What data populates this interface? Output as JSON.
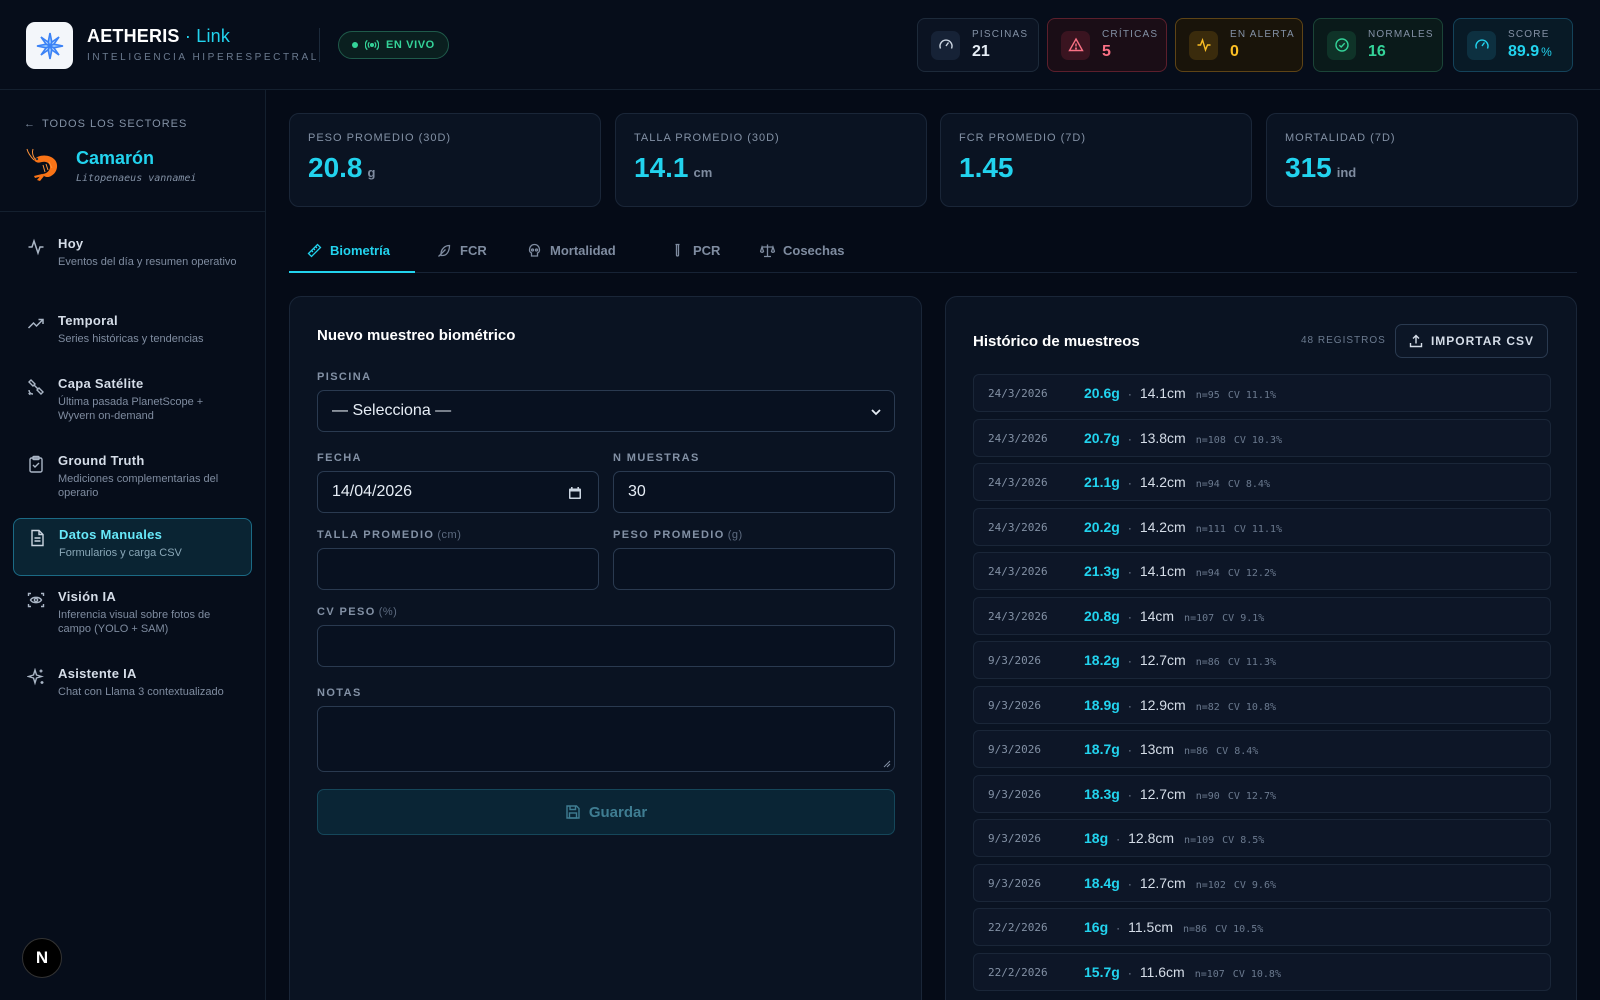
{
  "header": {
    "brand": "AETHERIS",
    "brand_sep": " · ",
    "brand_suffix": "Link",
    "subtitle": "INTELIGENCIA HIPERESPECTRAL",
    "live_label": "EN VIVO",
    "stats": [
      {
        "label": "PISCINAS",
        "value": "21",
        "icon": "gauge-icon"
      },
      {
        "label": "CRÍTICAS",
        "value": "5",
        "icon": "warning-triangle-icon"
      },
      {
        "label": "EN ALERTA",
        "value": "0",
        "icon": "activity-pulse-icon"
      },
      {
        "label": "NORMALES",
        "value": "16",
        "icon": "check-circle-icon"
      },
      {
        "label": "SCORE",
        "value": "89.9",
        "unit": "%",
        "icon": "gauge-icon"
      }
    ]
  },
  "sidebar": {
    "back_label": "TODOS LOS SECTORES",
    "species_name": "Camarón",
    "species_scientific": "Litopenaeus vannamei",
    "items": [
      {
        "title": "Hoy",
        "subtitle": "Eventos del día y resumen operativo",
        "icon": "activity-icon"
      },
      {
        "title": "Temporal",
        "subtitle": "Series históricas y tendencias",
        "icon": "trending-up-icon"
      },
      {
        "title": "Capa Satélite",
        "subtitle": "Última pasada PlanetScope + Wyvern on-demand",
        "icon": "satellite-icon"
      },
      {
        "title": "Ground Truth",
        "subtitle": "Mediciones complementarias del operario",
        "icon": "clipboard-check-icon"
      },
      {
        "title": "Datos Manuales",
        "subtitle": "Formularios y carga CSV",
        "icon": "file-text-icon",
        "active": true
      },
      {
        "title": "Visión IA",
        "subtitle": "Inferencia visual sobre fotos de campo (YOLO + SAM)",
        "icon": "scan-eye-icon"
      },
      {
        "title": "Asistente IA",
        "subtitle": "Chat con Llama 3 contextualizado",
        "icon": "sparkles-icon"
      }
    ]
  },
  "kpis": [
    {
      "label": "PESO PROMEDIO (30D)",
      "value": "20.8",
      "unit": "g"
    },
    {
      "label": "TALLA PROMEDIO (30D)",
      "value": "14.1",
      "unit": "cm"
    },
    {
      "label": "FCR PROMEDIO (7D)",
      "value": "1.45",
      "unit": ""
    },
    {
      "label": "MORTALIDAD (7D)",
      "value": "315",
      "unit": "ind"
    }
  ],
  "tabs": [
    {
      "label": "Biometría",
      "icon": "ruler-icon",
      "active": true
    },
    {
      "label": "FCR",
      "icon": "feather-icon"
    },
    {
      "label": "Mortalidad",
      "icon": "skull-icon"
    },
    {
      "label": "PCR",
      "icon": "test-tube-icon"
    },
    {
      "label": "Cosechas",
      "icon": "scale-icon"
    }
  ],
  "form": {
    "title": "Nuevo muestreo biométrico",
    "piscina_label": "PISCINA",
    "piscina_value": "— Selecciona —",
    "fecha_label": "FECHA",
    "fecha_value": "14/04/2026",
    "n_label": "N MUESTRAS",
    "n_value": "30",
    "talla_label": "TALLA PROMEDIO",
    "talla_unit": "(cm)",
    "talla_value": "",
    "peso_label": "PESO PROMEDIO",
    "peso_unit": "(g)",
    "peso_value": "",
    "cv_label": "CV PESO",
    "cv_unit": "(%)",
    "cv_value": "",
    "notas_label": "NOTAS",
    "notas_value": "",
    "save_label": "Guardar"
  },
  "history": {
    "title": "Histórico de muestreos",
    "count_label": "48 REGISTROS",
    "import_label": "IMPORTAR CSV",
    "rows": [
      {
        "date": "24/3/2026",
        "weight": "20.6g",
        "length": "14.1cm",
        "n": "n=95",
        "cv": "CV 11.1%"
      },
      {
        "date": "24/3/2026",
        "weight": "20.7g",
        "length": "13.8cm",
        "n": "n=108",
        "cv": "CV 10.3%"
      },
      {
        "date": "24/3/2026",
        "weight": "21.1g",
        "length": "14.2cm",
        "n": "n=94",
        "cv": "CV 8.4%"
      },
      {
        "date": "24/3/2026",
        "weight": "20.2g",
        "length": "14.2cm",
        "n": "n=111",
        "cv": "CV 11.1%"
      },
      {
        "date": "24/3/2026",
        "weight": "21.3g",
        "length": "14.1cm",
        "n": "n=94",
        "cv": "CV 12.2%"
      },
      {
        "date": "24/3/2026",
        "weight": "20.8g",
        "length": "14cm",
        "n": "n=107",
        "cv": "CV 9.1%"
      },
      {
        "date": "9/3/2026",
        "weight": "18.2g",
        "length": "12.7cm",
        "n": "n=86",
        "cv": "CV 11.3%"
      },
      {
        "date": "9/3/2026",
        "weight": "18.9g",
        "length": "12.9cm",
        "n": "n=82",
        "cv": "CV 10.8%"
      },
      {
        "date": "9/3/2026",
        "weight": "18.7g",
        "length": "13cm",
        "n": "n=86",
        "cv": "CV 8.4%"
      },
      {
        "date": "9/3/2026",
        "weight": "18.3g",
        "length": "12.7cm",
        "n": "n=90",
        "cv": "CV 12.7%"
      },
      {
        "date": "9/3/2026",
        "weight": "18g",
        "length": "12.8cm",
        "n": "n=109",
        "cv": "CV 8.5%"
      },
      {
        "date": "9/3/2026",
        "weight": "18.4g",
        "length": "12.7cm",
        "n": "n=102",
        "cv": "CV 9.6%"
      },
      {
        "date": "22/2/2026",
        "weight": "16g",
        "length": "11.5cm",
        "n": "n=86",
        "cv": "CV 10.5%"
      },
      {
        "date": "22/2/2026",
        "weight": "15.7g",
        "length": "11.6cm",
        "n": "n=107",
        "cv": "CV 10.8%"
      }
    ]
  },
  "footer": {
    "badge": "N"
  },
  "colors": {
    "accent": "#22d3ee",
    "critical": "#fb7185",
    "alert": "#fbbf24",
    "normal": "#34d399",
    "background": "#050b17"
  }
}
